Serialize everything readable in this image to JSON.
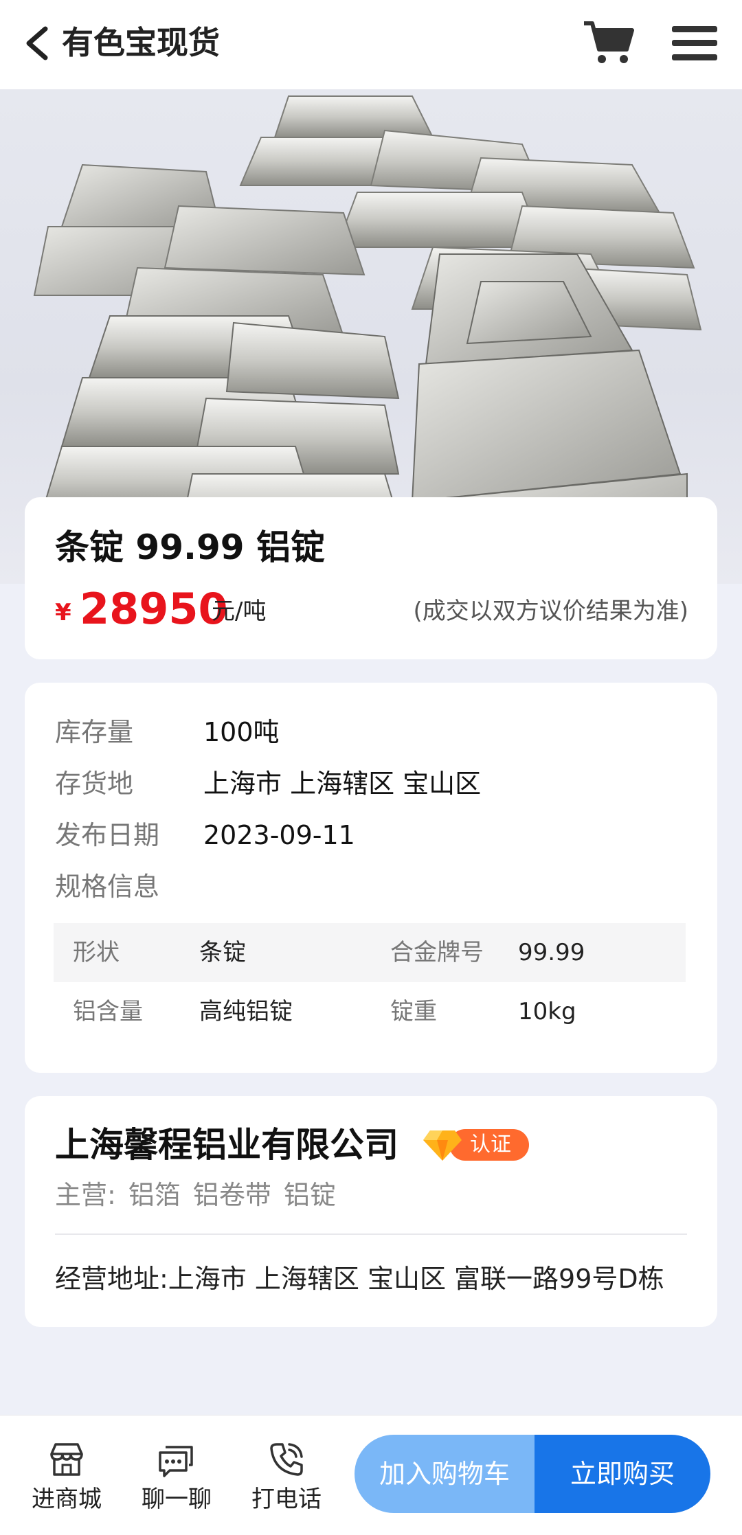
{
  "header": {
    "title": "有色宝现货",
    "back_icon": "chevron-left-icon",
    "cart_icon": "cart-icon",
    "menu_icon": "menu-icon"
  },
  "product": {
    "title": "条锭 99.99 铝锭",
    "currency_symbol": "¥",
    "price": "28950",
    "price_unit": "元/吨",
    "price_note": "(成交以双方议价结果为准)",
    "price_color": "#e8141c"
  },
  "info": {
    "rows": [
      {
        "label": "库存量",
        "value": "100吨"
      },
      {
        "label": "存货地",
        "value": "上海市 上海辖区 宝山区"
      },
      {
        "label": "发布日期",
        "value": "2023-09-11"
      },
      {
        "label": "规格信息",
        "value": ""
      }
    ],
    "specs": [
      {
        "k1": "形状",
        "v1": "条锭",
        "k2": "合金牌号",
        "v2": "99.99"
      },
      {
        "k1": "铝含量",
        "v1": "高纯铝锭",
        "k2": "锭重",
        "v2": "10kg"
      }
    ]
  },
  "company": {
    "name": "上海馨程铝业有限公司",
    "badge_label": "认证",
    "badge_icon": "diamond-icon",
    "main_label": "主营:",
    "main_items": [
      "铝箔",
      "铝卷带",
      "铝锭"
    ],
    "address": "经营地址:上海市 上海辖区 宝山区 富联一路99号D栋"
  },
  "bottom": {
    "shop": {
      "label": "进商城",
      "icon": "store-icon"
    },
    "chat": {
      "label": "聊一聊",
      "icon": "chat-icon"
    },
    "call": {
      "label": "打电话",
      "icon": "phone-icon"
    },
    "add_cart": "加入购物车",
    "buy_now": "立即购买",
    "accent_light": "#7ab7f7",
    "accent": "#1875e8"
  }
}
